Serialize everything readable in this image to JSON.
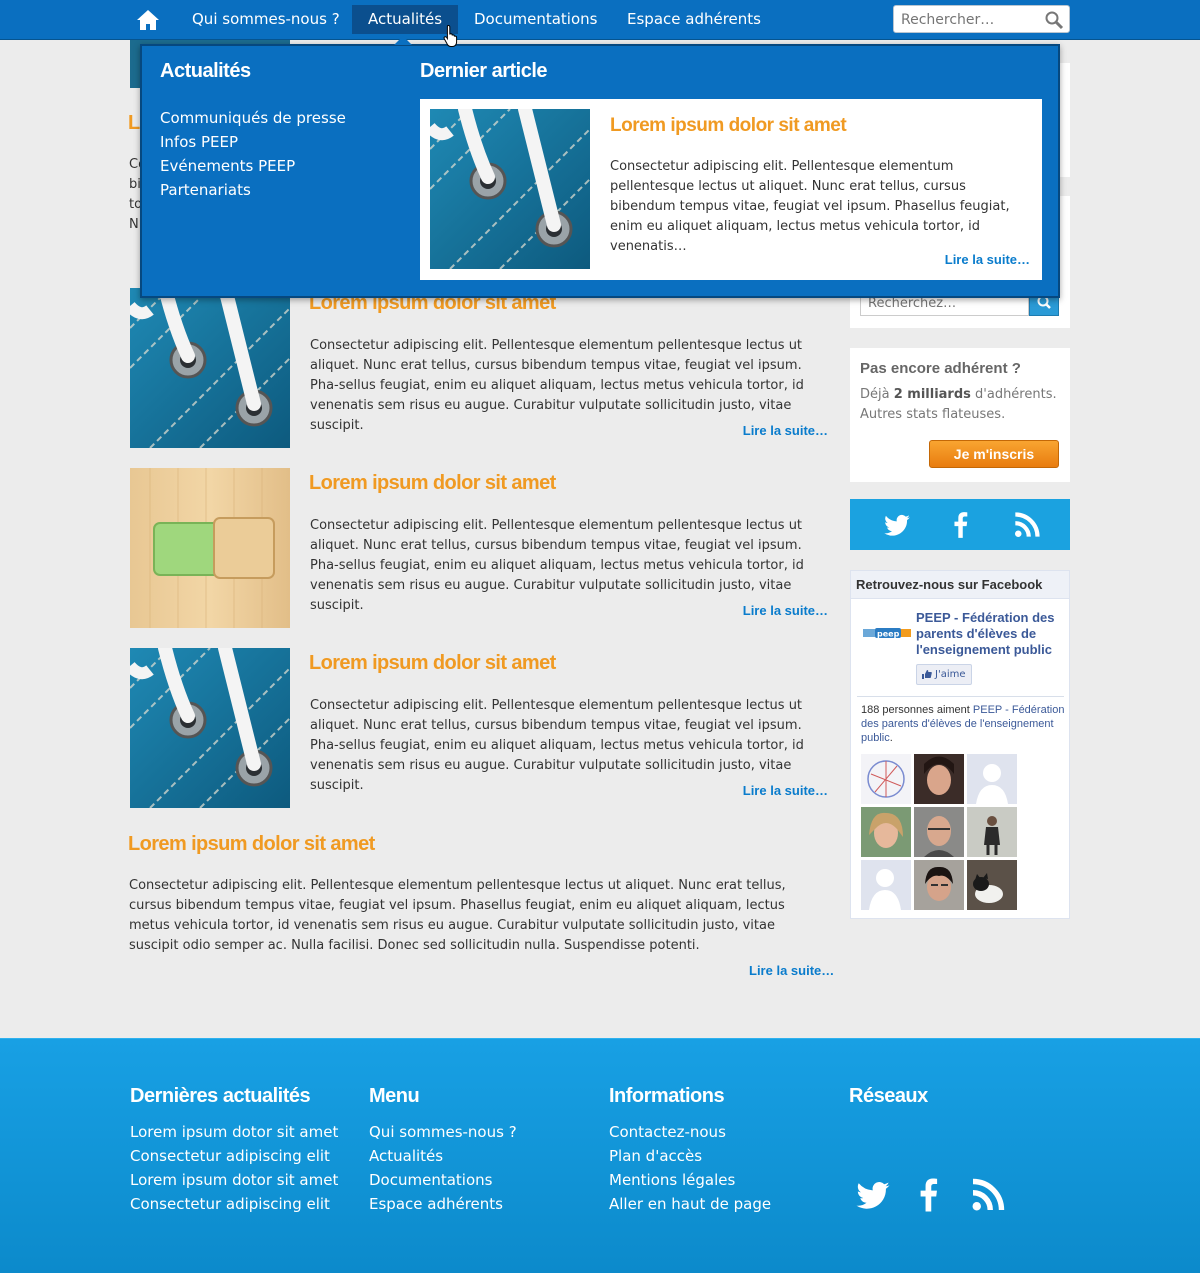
{
  "nav": {
    "items": [
      "Qui sommes-nous ?",
      "Actualités",
      "Documentations",
      "Espace adhérents"
    ],
    "search_placeholder": "Rechercher…"
  },
  "dropdown": {
    "left_title": "Actualités",
    "links": [
      "Communiqués de presse",
      "Infos PEEP",
      "Evénements PEEP",
      "Partenariats"
    ],
    "right_title": "Dernier article",
    "article": {
      "title": "Lorem ipsum dolor sit amet",
      "text": "Consectetur adipiscing elit. Pellentesque elementum pellentesque lectus ut aliquet. Nunc erat tellus, cursus bibendum tempus vitae, feugiat vel ipsum. Phasellus feugiat, enim eu aliquet aliquam, lectus metus  vehicula tortor, id venenatis…",
      "more": "Lire la suite…"
    }
  },
  "peek": {
    "title": "Lo",
    "lines": [
      "Co",
      "bi",
      "to",
      "N"
    ]
  },
  "articles": [
    {
      "title": "Lorem ipsum dolor sit amet",
      "text": "Consectetur adipiscing elit. Pellentesque elementum pellentesque lectus ut aliquet. Nunc erat tellus, cursus bibendum tempus vitae, feugiat vel ipsum. Pha-sellus feugiat, enim eu aliquet aliquam, lectus metus vehicula tortor, id venenatis sem risus eu augue. Curabitur vulputate sollicitudin justo, vitae suscipit.",
      "more": "Lire la suite…",
      "image": "shoe-lace-image"
    },
    {
      "title": "Lorem ipsum dolor sit amet",
      "text": "Consectetur adipiscing elit. Pellentesque elementum pellentesque lectus ut aliquet. Nunc erat tellus, cursus bibendum tempus vitae, feugiat vel ipsum. Pha-sellus feugiat, enim eu aliquet aliquam, lectus metus vehicula tortor, id venenatis sem risus eu augue. Curabitur vulputate sollicitudin justo, vitae suscipit.",
      "more": "Lire la suite…",
      "image": "wood-toggle-image"
    },
    {
      "title": "Lorem ipsum dolor sit amet",
      "text": "Consectetur adipiscing elit. Pellentesque elementum pellentesque lectus ut aliquet. Nunc erat tellus, cursus bibendum tempus vitae, feugiat vel ipsum. Pha-sellus feugiat, enim eu aliquet aliquam, lectus metus vehicula tortor, id venenatis sem risus eu augue. Curabitur vulputate sollicitudin justo, vitae suscipit.",
      "more": "Lire la suite…",
      "image": "shoe-lace-image"
    }
  ],
  "wide_article": {
    "title": "Lorem ipsum dolor sit amet",
    "text": "Consectetur adipiscing elit. Pellentesque elementum pellentesque lectus ut aliquet. Nunc erat tellus, cursus bibendum tempus vitae, feugiat vel ipsum. Phasellus feugiat, enim eu aliquet aliquam, lectus metus vehicula tortor, id venenatis sem risus eu augue. Curabitur vulputate sollicitudin justo, vitae suscipit odio semper ac. Nulla facilisi. Donec sed sollicitudin nulla. Suspendisse potenti.",
    "more": "Lire la suite…"
  },
  "sidebar": {
    "search_placeholder": "Recherchez…",
    "join": {
      "title": "Pas encore adhérent ?",
      "text_prefix": "Déjà ",
      "text_bold": "2 milliards",
      "text_suffix": " d'adhérents.",
      "text_line2": "Autres stats flateuses.",
      "button": "Je m'inscris"
    },
    "social": [
      "twitter-icon",
      "facebook-icon",
      "rss-icon"
    ],
    "facebook": {
      "header": "Retrouvez-nous sur Facebook",
      "page_name": "PEEP - Fédération des parents d'élèves de l'enseignement public",
      "like_label": "J'aime",
      "count_prefix": "188 personnes aiment ",
      "count_link": "PEEP - Fédération des parents d'élèves de l'enseignement public",
      "count_suffix": "."
    }
  },
  "footer": {
    "columns": [
      {
        "title": "Dernières actualités",
        "links": [
          "Lorem ipsum dotor sit amet",
          "Consectetur adipiscing elit",
          "Lorem ipsum dotor sit amet",
          "Consectetur adipiscing elit"
        ]
      },
      {
        "title": "Menu",
        "links": [
          "Qui sommes-nous ?",
          "Actualités",
          "Documentations",
          "Espace adhérents"
        ]
      },
      {
        "title": "Informations",
        "links": [
          "Contactez-nous",
          "Plan d'accès",
          "Mentions légales",
          "Aller en haut de page"
        ]
      },
      {
        "title": "Réseaux",
        "links": []
      }
    ]
  },
  "colors": {
    "nav_blue": "#0a6fc0",
    "accent_orange": "#f09a22",
    "link_blue": "#0a7ccc",
    "footer_blue": "#18a0e4"
  }
}
